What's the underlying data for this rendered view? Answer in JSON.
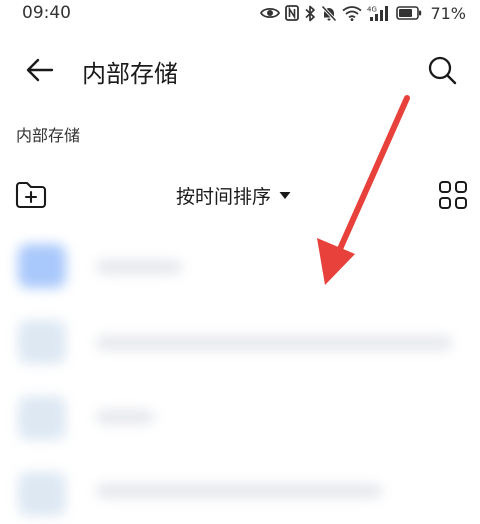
{
  "status_bar": {
    "time": "09:40",
    "network_label": "4G",
    "battery": "71%"
  },
  "app_bar": {
    "title": "内部存储",
    "back_icon": "arrow-left-icon",
    "search_icon": "search-icon"
  },
  "breadcrumb": "内部存储",
  "toolbar": {
    "new_folder_icon": "folder-add-icon",
    "sort_label": "按时间排序",
    "sort_icon": "triangle-down-icon",
    "view_icon": "grid-view-icon"
  },
  "colors": {
    "annotation_arrow": "#e8403a",
    "folder_icon_first": "#a9c8fb",
    "folder_icon": "#dde8f3"
  }
}
